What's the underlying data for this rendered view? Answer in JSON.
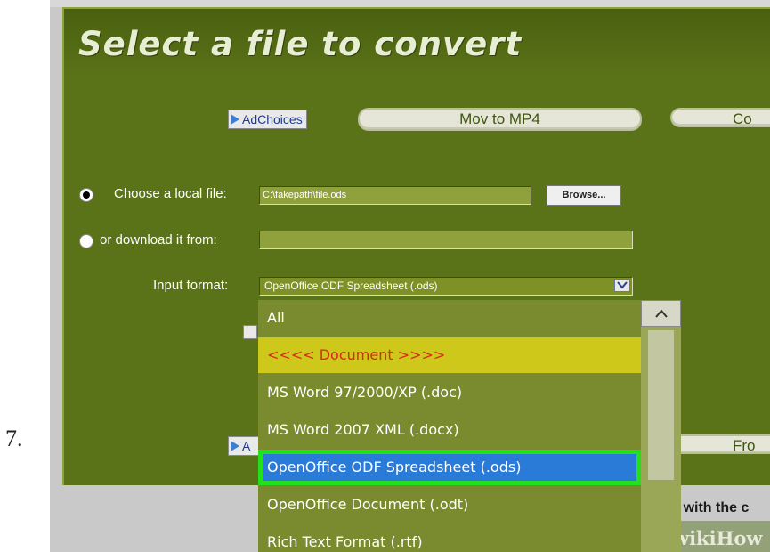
{
  "step_number": "7.",
  "page_title": "Select a file to convert",
  "ad_choices_label": "AdChoices",
  "top_buttons": [
    "Mov to MP4",
    "Co"
  ],
  "bottom_buttons": [
    "A",
    "Fro"
  ],
  "local_file": {
    "label": "Choose a local file:",
    "value": "C:\\fakepath\\file.ods",
    "browse_label": "Browse...",
    "selected": true
  },
  "download": {
    "label": "or download it from:",
    "value": "",
    "selected": false
  },
  "input_format": {
    "label": "Input format:",
    "selected_value": "OpenOffice ODF Spreadsheet (.ods)"
  },
  "dropdown_options": [
    {
      "label": "All",
      "kind": "normal"
    },
    {
      "label": "<<<< Document >>>>",
      "kind": "group"
    },
    {
      "label": "MS Word 97/2000/XP (.doc)",
      "kind": "normal"
    },
    {
      "label": "MS Word 2007 XML (.docx)",
      "kind": "normal"
    },
    {
      "label": "OpenOffice ODF Spreadsheet (.ods)",
      "kind": "selected"
    },
    {
      "label": "OpenOffice Document (.odt)",
      "kind": "normal"
    },
    {
      "label": "Rich Text Format (.rtf)",
      "kind": "normal"
    }
  ],
  "footer_text": "re with the c",
  "watermark": "wikiHow",
  "colors": {
    "panel": "#5b7318",
    "group_highlight": "#cdc819",
    "selected_option": "#2a7ad8",
    "selection_outline": "#22e01c"
  }
}
